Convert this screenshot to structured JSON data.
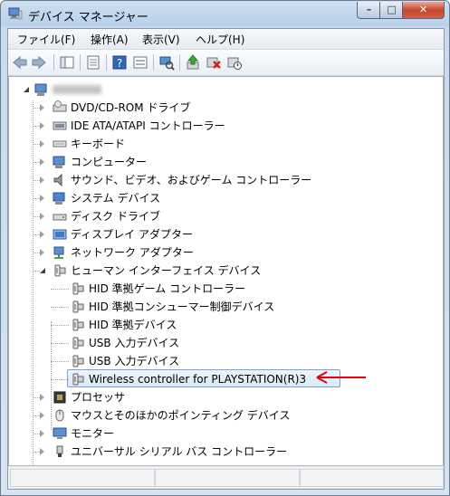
{
  "window": {
    "title": "デバイス マネージャー",
    "buttons": {
      "minimize": "–",
      "maximize": "□",
      "close": "✕"
    }
  },
  "menu": [
    {
      "label": "ファイル(F)"
    },
    {
      "label": "操作(A)"
    },
    {
      "label": "表示(V)"
    },
    {
      "label": "ヘルプ(H)"
    }
  ],
  "toolbar": [
    {
      "name": "back-icon"
    },
    {
      "name": "forward-icon"
    },
    {
      "name": "show-hide-tree-icon"
    },
    {
      "name": "properties-icon"
    },
    {
      "name": "help-icon"
    },
    {
      "name": "view-icon"
    },
    {
      "name": "scan-hardware-icon"
    },
    {
      "name": "update-driver-icon"
    },
    {
      "name": "uninstall-icon"
    },
    {
      "name": "disable-icon"
    }
  ],
  "tree": {
    "items": [
      {
        "label": "DVD/CD-ROM ドライブ",
        "icon": "dvd-drive-icon"
      },
      {
        "label": "IDE ATA/ATAPI コントローラー",
        "icon": "ide-controller-icon"
      },
      {
        "label": "キーボード",
        "icon": "keyboard-icon"
      },
      {
        "label": "コンピューター",
        "icon": "computer-icon"
      },
      {
        "label": "サウンド、ビデオ、およびゲーム コントローラー",
        "icon": "sound-icon"
      },
      {
        "label": "システム デバイス",
        "icon": "system-device-icon"
      },
      {
        "label": "ディスク ドライブ",
        "icon": "disk-drive-icon"
      },
      {
        "label": "ディスプレイ アダプター",
        "icon": "display-adapter-icon"
      },
      {
        "label": "ネットワーク アダプター",
        "icon": "network-adapter-icon"
      },
      {
        "label": "ヒューマン インターフェイス デバイス",
        "icon": "hid-icon"
      },
      {
        "label": "HID 準拠ゲーム コントローラー",
        "icon": "hid-icon"
      },
      {
        "label": "HID 準拠コンシューマー制御デバイス",
        "icon": "hid-icon"
      },
      {
        "label": "HID 準拠デバイス",
        "icon": "hid-icon"
      },
      {
        "label": "USB 入力デバイス",
        "icon": "hid-icon"
      },
      {
        "label": "USB 入力デバイス",
        "icon": "hid-icon"
      },
      {
        "label": "Wireless controller for PLAYSTATION(R)3",
        "icon": "hid-icon"
      },
      {
        "label": "プロセッサ",
        "icon": "processor-icon"
      },
      {
        "label": "マウスとそのほかのポインティング デバイス",
        "icon": "mouse-icon"
      },
      {
        "label": "モニター",
        "icon": "monitor-icon"
      },
      {
        "label": "ユニバーサル シリアル バス コントローラー",
        "icon": "usb-icon"
      }
    ]
  },
  "colors": {
    "arrow": "#e8000d",
    "selection_border": "#7da2ce"
  }
}
